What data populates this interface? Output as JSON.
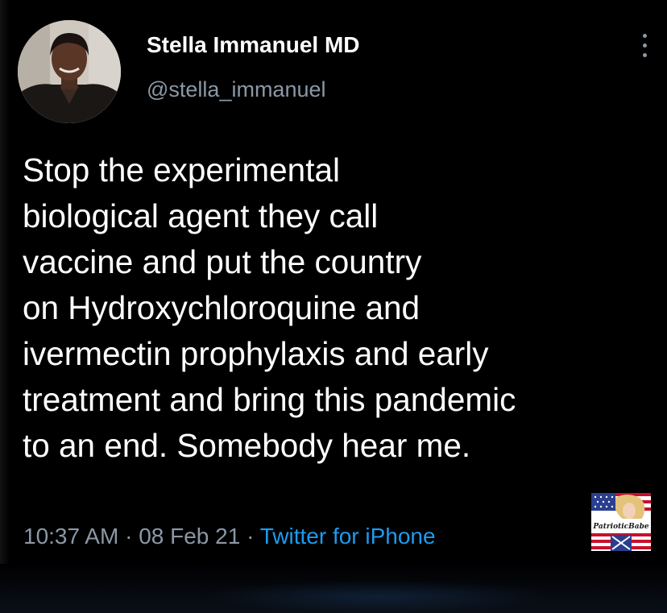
{
  "author": {
    "display_name": "Stella Immanuel MD",
    "handle": "@stella_immanuel",
    "avatar_icon": "profile-photo"
  },
  "tweet": {
    "lines": [
      "Stop the experimental",
      "biological agent they call",
      "vaccine and put the country",
      "on Hydroxychloroquine and",
      "ivermectin prophylaxis and early",
      "treatment and bring this pandemic",
      "to an end. Somebody hear me."
    ]
  },
  "meta": {
    "time": "10:37 AM",
    "separator": "·",
    "date": "08 Feb 21",
    "source": "Twitter for iPhone"
  },
  "watermark": {
    "text": "PatrioticBabe"
  },
  "colors": {
    "background": "#000000",
    "text": "#ffffff",
    "muted": "#8b98a5",
    "link": "#1d9bf0"
  }
}
